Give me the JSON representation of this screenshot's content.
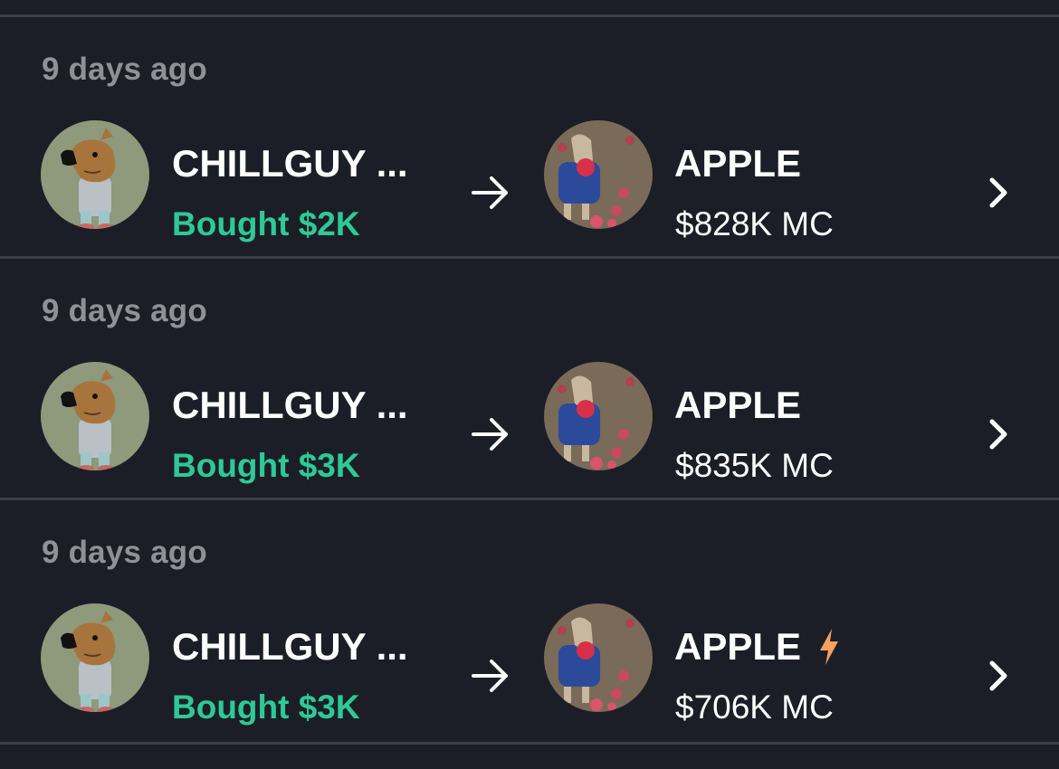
{
  "colors": {
    "background": "#1c1e27",
    "divider": "#3c3f48",
    "muted_text": "#8f9198",
    "buy_green": "#2ec996",
    "bolt_orange": "#f4a160"
  },
  "icons": {
    "arrow": "arrow-right-icon",
    "chevron": "chevron-right-icon",
    "bolt": "lightning-bolt-icon"
  },
  "trades": [
    {
      "time": "9 days ago",
      "from_token": "CHILLGUY ...",
      "action": "Bought $2K",
      "to_token": "APPLE",
      "market_cap": "$828K MC",
      "bolt": false
    },
    {
      "time": "9 days ago",
      "from_token": "CHILLGUY ...",
      "action": "Bought $3K",
      "to_token": "APPLE",
      "market_cap": "$835K MC",
      "bolt": false
    },
    {
      "time": "9 days ago",
      "from_token": "CHILLGUY ...",
      "action": "Bought $3K",
      "to_token": "APPLE",
      "market_cap": "$706K MC",
      "bolt": true
    }
  ]
}
